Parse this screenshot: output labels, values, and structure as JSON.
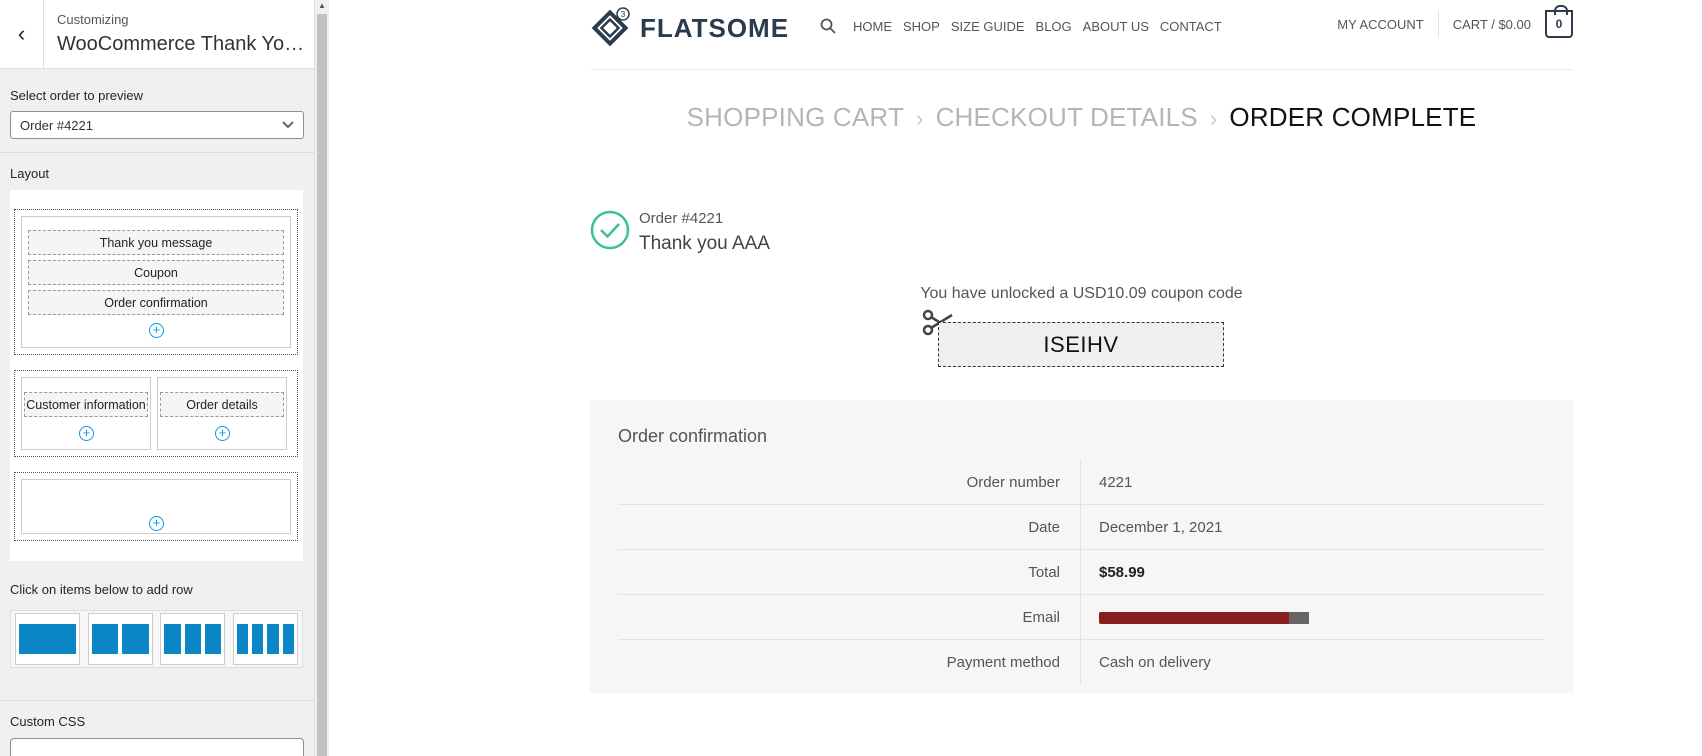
{
  "customizer": {
    "header_small": "Customizing",
    "header_title": "WooCommerce Thank You P...",
    "back_icon": "‹",
    "select_label": "Select order to preview",
    "select_value": "Order #4221",
    "layout_label": "Layout",
    "layout_blocks": {
      "thank_you": "Thank you message",
      "coupon": "Coupon",
      "order_confirmation": "Order confirmation",
      "customer_info": "Customer information",
      "order_details": "Order details"
    },
    "add_row_label": "Click on items below to add row",
    "custom_css_label": "Custom CSS",
    "plus_icon": "+"
  },
  "site": {
    "logo_text": "FLATSOME",
    "logo_badge": "3",
    "nav": [
      "HOME",
      "SHOP",
      "SIZE GUIDE",
      "BLOG",
      "ABOUT US",
      "CONTACT"
    ],
    "my_account": "MY ACCOUNT",
    "cart_label": "CART / $0.00",
    "cart_count": "0"
  },
  "checkout_steps": {
    "step1": "SHOPPING CART",
    "step2": "CHECKOUT DETAILS",
    "step3": "ORDER COMPLETE",
    "separator": "›"
  },
  "thank_you": {
    "order_number": "Order #4221",
    "message": "Thank you AAA"
  },
  "coupon": {
    "text": "You have unlocked a USD10.09 coupon code",
    "code": "ISEIHV"
  },
  "order_confirmation": {
    "title": "Order confirmation",
    "rows": [
      {
        "label": "Order number",
        "value": "4221"
      },
      {
        "label": "Date",
        "value": "December 1, 2021"
      },
      {
        "label": "Total",
        "value": "$58.99"
      },
      {
        "label": "Email",
        "value": ""
      },
      {
        "label": "Payment method",
        "value": "Cash on delivery"
      }
    ]
  },
  "colors": {
    "accent_blue": "#0a86c6",
    "check_green": "#3dbf9c",
    "logo_navy": "#2a3b4e"
  }
}
